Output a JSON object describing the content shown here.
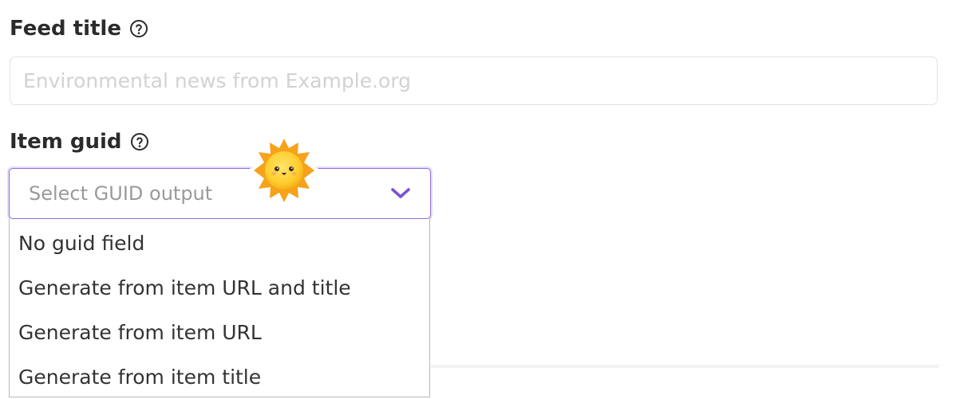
{
  "feed_title": {
    "label": "Feed title",
    "placeholder": "Environmental news from Example.org",
    "value": ""
  },
  "item_guid": {
    "label": "Item guid",
    "placeholder": "Select GUID output",
    "options": [
      "No guid field",
      "Generate from item URL and title",
      "Generate from item URL",
      "Generate from item title"
    ]
  },
  "colors": {
    "accent": "#8e6fdc",
    "text": "#2b2b2b",
    "placeholder": "#9a9a9a"
  },
  "icons": {
    "help": "question-circle-icon",
    "select_chevron": "chevron-down-icon",
    "sticker": "sun-sticker-icon"
  }
}
